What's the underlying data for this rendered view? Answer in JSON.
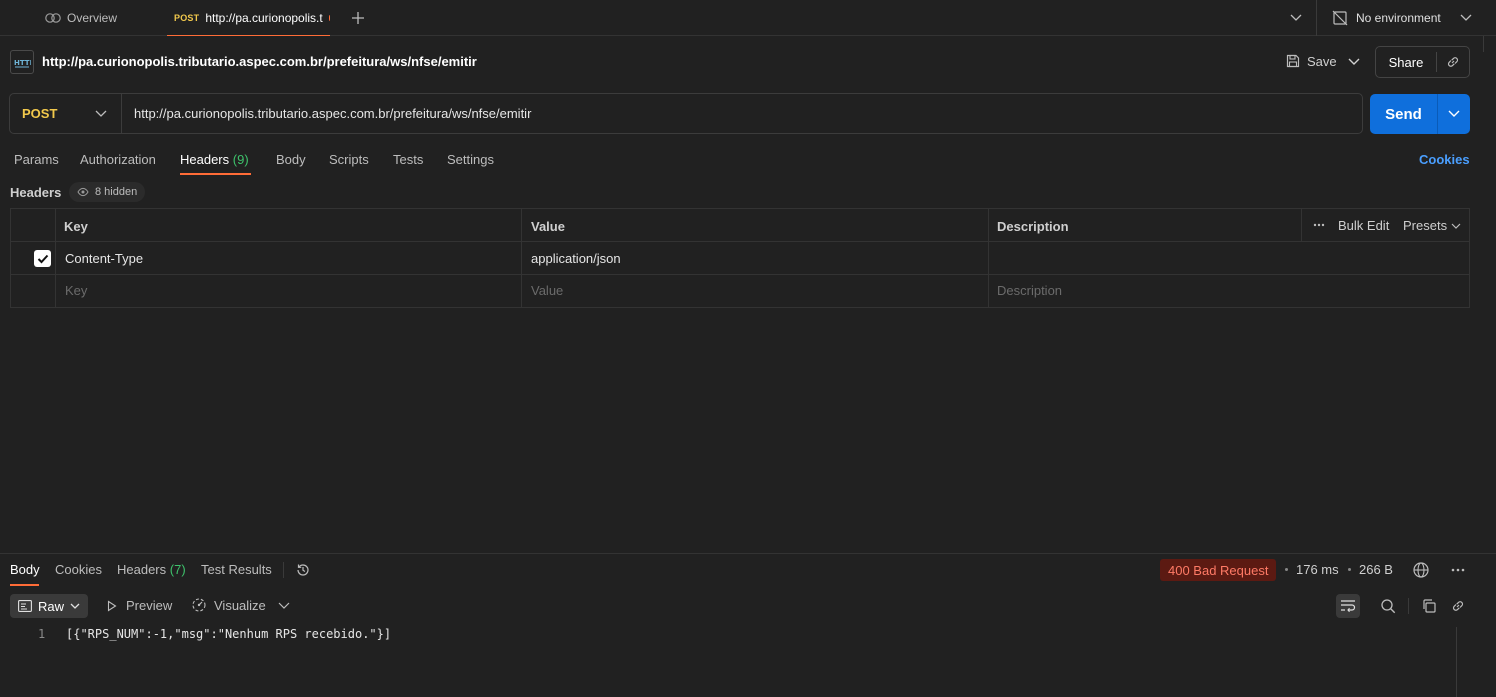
{
  "tabs": {
    "overview_label": "Overview",
    "active_method": "POST",
    "active_title": "http://pa.curionopolis.t",
    "environment": "No environment"
  },
  "request": {
    "title": "http://pa.curionopolis.tributario.aspec.com.br/prefeitura/ws/nfse/emitir",
    "save_label": "Save",
    "share_label": "Share",
    "method": "POST",
    "url": "http://pa.curionopolis.tributario.aspec.com.br/prefeitura/ws/nfse/emitir",
    "send_label": "Send"
  },
  "request_tabs": {
    "params": "Params",
    "authorization": "Authorization",
    "headers": "Headers",
    "headers_count": "(9)",
    "body": "Body",
    "scripts": "Scripts",
    "tests": "Tests",
    "settings": "Settings",
    "cookies": "Cookies"
  },
  "headers_section": {
    "label": "Headers",
    "hidden": "8 hidden",
    "columns": {
      "key": "Key",
      "value": "Value",
      "description": "Description"
    },
    "bulk_edit": "Bulk Edit",
    "presets": "Presets",
    "rows": [
      {
        "checked": true,
        "key": "Content-Type",
        "value": "application/json",
        "description": ""
      }
    ],
    "placeholders": {
      "key": "Key",
      "value": "Value",
      "description": "Description"
    }
  },
  "response": {
    "tabs": {
      "body": "Body",
      "cookies": "Cookies",
      "headers": "Headers",
      "headers_count": "(7)",
      "test_results": "Test Results"
    },
    "status": "400 Bad Request",
    "time": "176 ms",
    "size": "266 B",
    "format": "Raw",
    "preview": "Preview",
    "visualize": "Visualize",
    "line_number": "1",
    "body": "[{\"RPS_NUM\":-1,\"msg\":\"Nenhum RPS recebido.\"}]"
  }
}
